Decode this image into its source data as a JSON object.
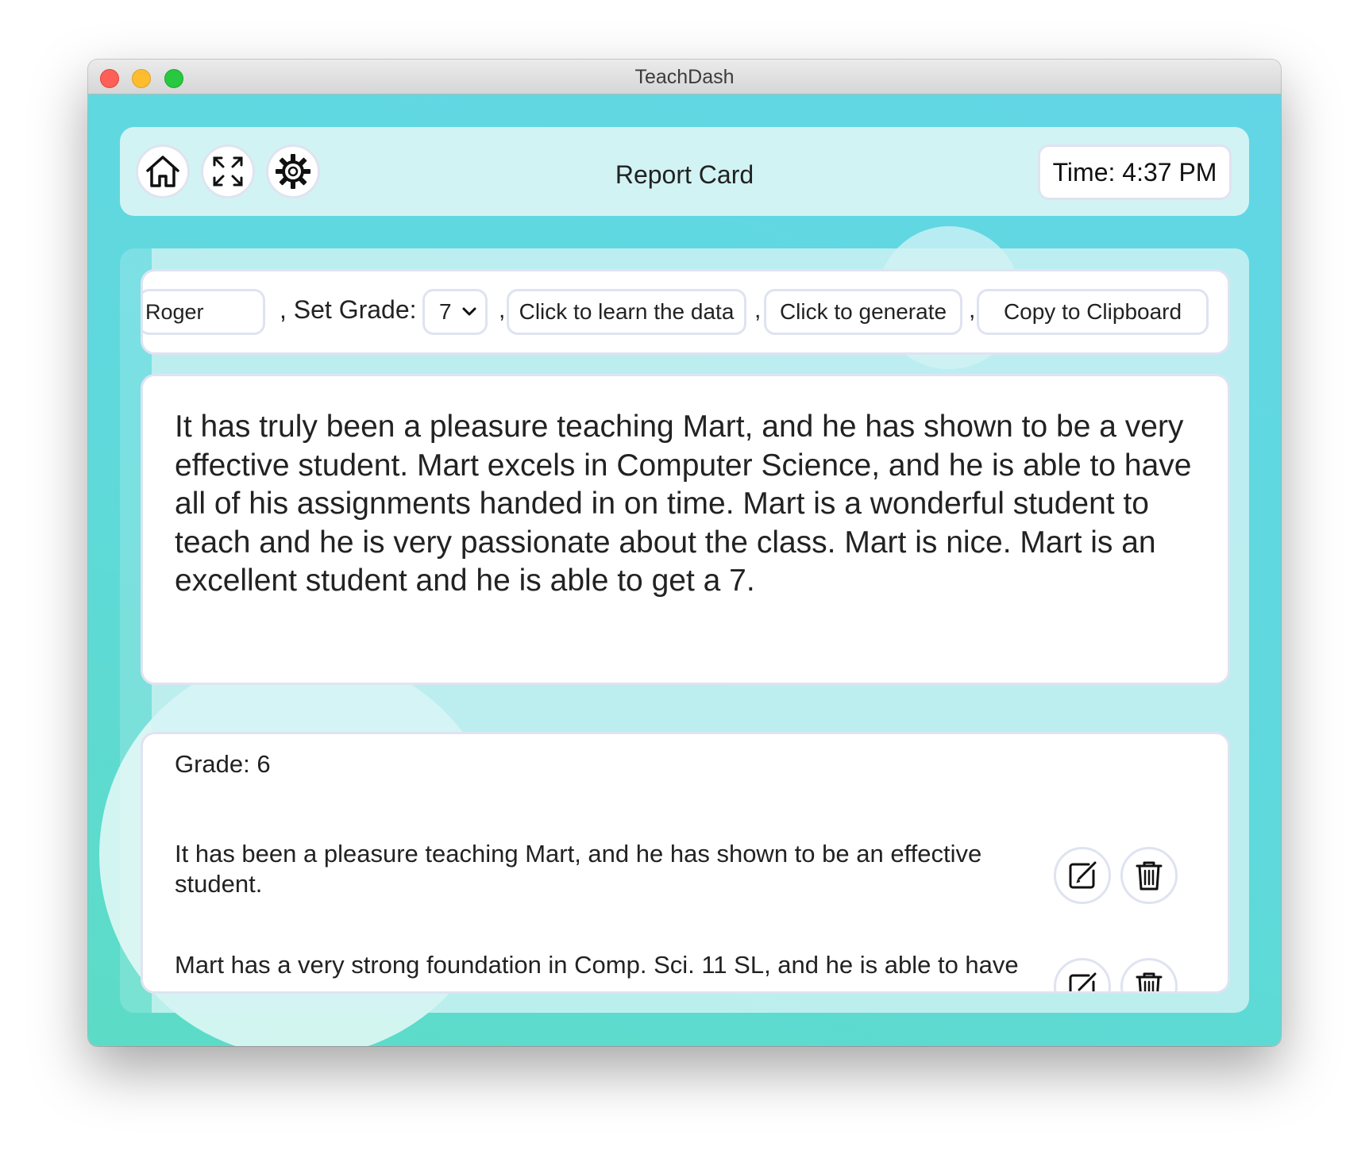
{
  "window": {
    "title": "TeachDash"
  },
  "header": {
    "page_title": "Report Card",
    "time_label": "Time: 4:37 PM",
    "icons": [
      "home-icon",
      "fullscreen-icon",
      "gear-icon"
    ]
  },
  "controls": {
    "name_value": "Roger",
    "set_grade_label": ", Set Grade:",
    "grade_value": "7",
    "separator": ",",
    "learn_button": "Click to learn the data",
    "generate_button": "Click to generate",
    "copy_button": "Copy to Clipboard"
  },
  "report": {
    "text": " It has truly been a pleasure teaching Mart, and he has shown to be a very effective student. Mart excels in Computer Science, and he is able to have all of his assignments handed in on time. Mart is a wonderful student to teach and he is very passionate about the class. Mart is nice. Mart is an excellent student and he is able to get a 7."
  },
  "history": {
    "grade_heading": "Grade: 6",
    "comments": [
      "It has been a pleasure teaching Mart, and he has shown to be an effective student.",
      "Mart has a very strong foundation in Comp. Sci. 11 SL, and he is able to have"
    ]
  },
  "colors": {
    "window_gradient_top": "#62d6e6",
    "window_gradient_bottom": "#5cdcc6",
    "panel": "#d2f3f4",
    "border": "#dfe3f1"
  }
}
